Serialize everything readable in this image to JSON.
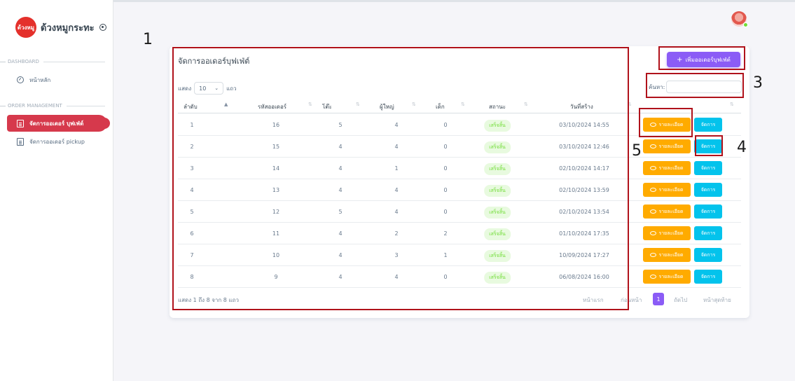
{
  "sidebar": {
    "brand_logo_text": "ด้วงหมู",
    "brand_name": "ด้วงหมูกระทะ",
    "section_dashboard": "DASHBOARD",
    "home_label": "หน้าหลัก",
    "section_orders": "ORDER MANAGEMENT",
    "buffet_label": "จัดการออเดอร์ บุฟเฟ่ต์",
    "pickup_label": "จัดการออเดอร์ pickup"
  },
  "card": {
    "title": "จัดการออเดอร์บุฟเฟ่ต์",
    "add_button": "เพิ่มออเดอร์บุฟเฟ่ต์",
    "show_prefix": "แสดง",
    "page_size": "10",
    "show_suffix": "แถว",
    "search_label": "ค้นหา:",
    "columns": [
      "ลำดับ",
      "รหัสออเดอร์",
      "โต๊ะ",
      "ผู้ใหญ่",
      "เด็ก",
      "สถานะ",
      "วันที่สร้าง"
    ],
    "rows": [
      {
        "no": "1",
        "code": "16",
        "table": "5",
        "adult": "4",
        "child": "0",
        "status": "เสร็จสิ้น",
        "date": "03/10/2024 14:55"
      },
      {
        "no": "2",
        "code": "15",
        "table": "4",
        "adult": "4",
        "child": "0",
        "status": "เสร็จสิ้น",
        "date": "03/10/2024 12:46"
      },
      {
        "no": "3",
        "code": "14",
        "table": "4",
        "adult": "1",
        "child": "0",
        "status": "เสร็จสิ้น",
        "date": "02/10/2024 14:17"
      },
      {
        "no": "4",
        "code": "13",
        "table": "4",
        "adult": "4",
        "child": "0",
        "status": "เสร็จสิ้น",
        "date": "02/10/2024 13:59"
      },
      {
        "no": "5",
        "code": "12",
        "table": "5",
        "adult": "4",
        "child": "0",
        "status": "เสร็จสิ้น",
        "date": "02/10/2024 13:54"
      },
      {
        "no": "6",
        "code": "11",
        "table": "4",
        "adult": "2",
        "child": "2",
        "status": "เสร็จสิ้น",
        "date": "01/10/2024 17:35"
      },
      {
        "no": "7",
        "code": "10",
        "table": "4",
        "adult": "3",
        "child": "1",
        "status": "เสร็จสิ้น",
        "date": "10/09/2024 17:27"
      },
      {
        "no": "8",
        "code": "9",
        "table": "4",
        "adult": "4",
        "child": "0",
        "status": "เสร็จสิ้น",
        "date": "06/08/2024 16:00"
      }
    ],
    "detail_button": "รายละเอียด",
    "manage_button": "จัดการ",
    "info_text": "แสดง 1 ถึง 8 จาก 8 แถว",
    "pager": {
      "first": "หน้าแรก",
      "prev": "ก่อนหน้า",
      "current": "1",
      "next": "ถัดไป",
      "last": "หน้าสุดท้าย"
    }
  },
  "annotations": {
    "n1": "1",
    "n3": "3",
    "n4": "4",
    "n5": "5"
  },
  "colors": {
    "accent": "#8b5cf6",
    "active_menu": "#d6394c",
    "warning": "#ffab00",
    "info": "#03c3ec",
    "success": "#71dd37",
    "annotation": "#b0121b"
  }
}
